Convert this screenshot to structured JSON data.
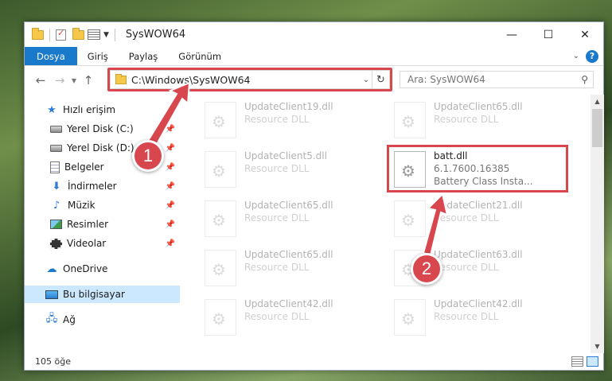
{
  "window": {
    "title": "SysWOW64"
  },
  "ribbon": {
    "tabs": [
      "Dosya",
      "Giriş",
      "Paylaş",
      "Görünüm"
    ]
  },
  "navbar": {
    "address": "C:\\Windows\\SysWOW64",
    "search_placeholder": "Ara: SysWOW64"
  },
  "sidebar": {
    "items": [
      {
        "label": "Hızlı erişim",
        "icon": "star-icon"
      },
      {
        "label": "Yerel Disk (C:)",
        "icon": "drive-icon"
      },
      {
        "label": "Yerel Disk (D:)",
        "icon": "drive-icon"
      },
      {
        "label": "Belgeler",
        "icon": "document-icon"
      },
      {
        "label": "İndirmeler",
        "icon": "download-icon"
      },
      {
        "label": "Müzik",
        "icon": "music-icon"
      },
      {
        "label": "Resimler",
        "icon": "pictures-icon"
      },
      {
        "label": "Videolar",
        "icon": "video-icon"
      },
      {
        "label": "OneDrive",
        "icon": "cloud-icon"
      },
      {
        "label": "Bu bilgisayar",
        "icon": "computer-icon"
      },
      {
        "label": "Ağ",
        "icon": "network-icon"
      }
    ]
  },
  "files": {
    "left": [
      {
        "name": "UpdateClient19.dll",
        "sub": "Resource DLL"
      },
      {
        "name": "UpdateClient5.dll",
        "sub": "Resource DLL"
      },
      {
        "name": "UpdateClient65.dll",
        "sub": "Resource DLL"
      },
      {
        "name": "UpdateClient65.dll",
        "sub": "Resource DLL"
      },
      {
        "name": "UpdateClient42.dll",
        "sub": "Resource DLL"
      }
    ],
    "right": [
      {
        "name": "UpdateClient65.dll",
        "sub": "Resource DLL"
      },
      {
        "name": "UpdateClient21.dll",
        "sub": "Resource DLL"
      },
      {
        "name": "UpdateClient63.dll",
        "sub": "Resource DLL"
      },
      {
        "name": "UpdateClient42.dll",
        "sub": "Resource DLL"
      }
    ],
    "highlighted": {
      "name": "batt.dll",
      "version": "6.1.7600.16385",
      "description": "Battery Class Insta..."
    }
  },
  "status": {
    "count": "105 öğe"
  },
  "annotations": {
    "step1": "1",
    "step2": "2",
    "color": "#d9474e"
  }
}
